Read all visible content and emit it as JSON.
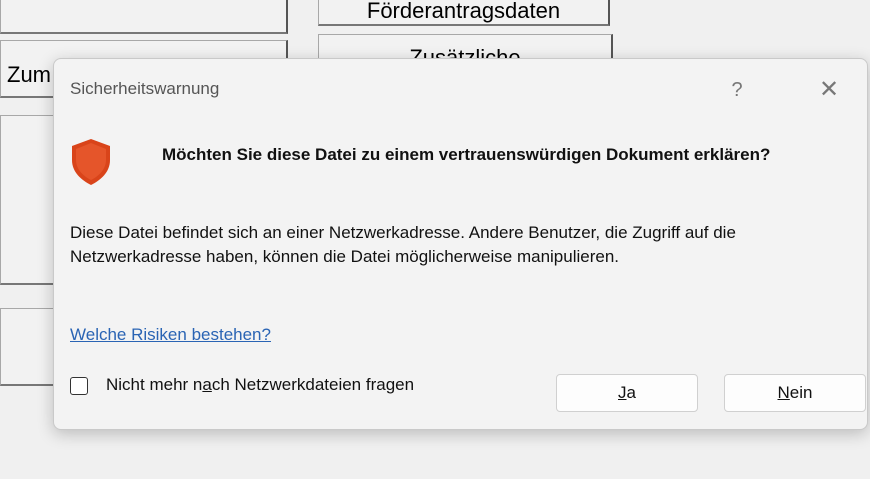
{
  "background": {
    "button_top_right": "Förderantragsdaten",
    "button_left_partial": "Zum",
    "button_second_right": "Zusätzliche"
  },
  "dialog": {
    "title": "Sicherheitswarnung",
    "help_glyph": "?",
    "close_glyph": "✕",
    "question": "Möchten Sie diese Datei zu einem vertrauenswürdigen Dokument erklären?",
    "body": "Diese Datei befindet sich an einer Netzwerkadresse. Andere Benutzer, die Zugriff auf die Netzwerkadresse haben, können die Datei möglicherweise manipulieren.",
    "link": "Welche Risiken bestehen?",
    "checkbox": {
      "label_before": "Nicht mehr n",
      "label_mnemonic": "a",
      "label_after": "ch Netzwerkdateien fragen",
      "checked": false
    },
    "yes_button": {
      "mnemonic": "J",
      "rest": "a"
    },
    "no_button": {
      "mnemonic": "N",
      "rest": "ein"
    },
    "shield_color": "#d9441a"
  }
}
